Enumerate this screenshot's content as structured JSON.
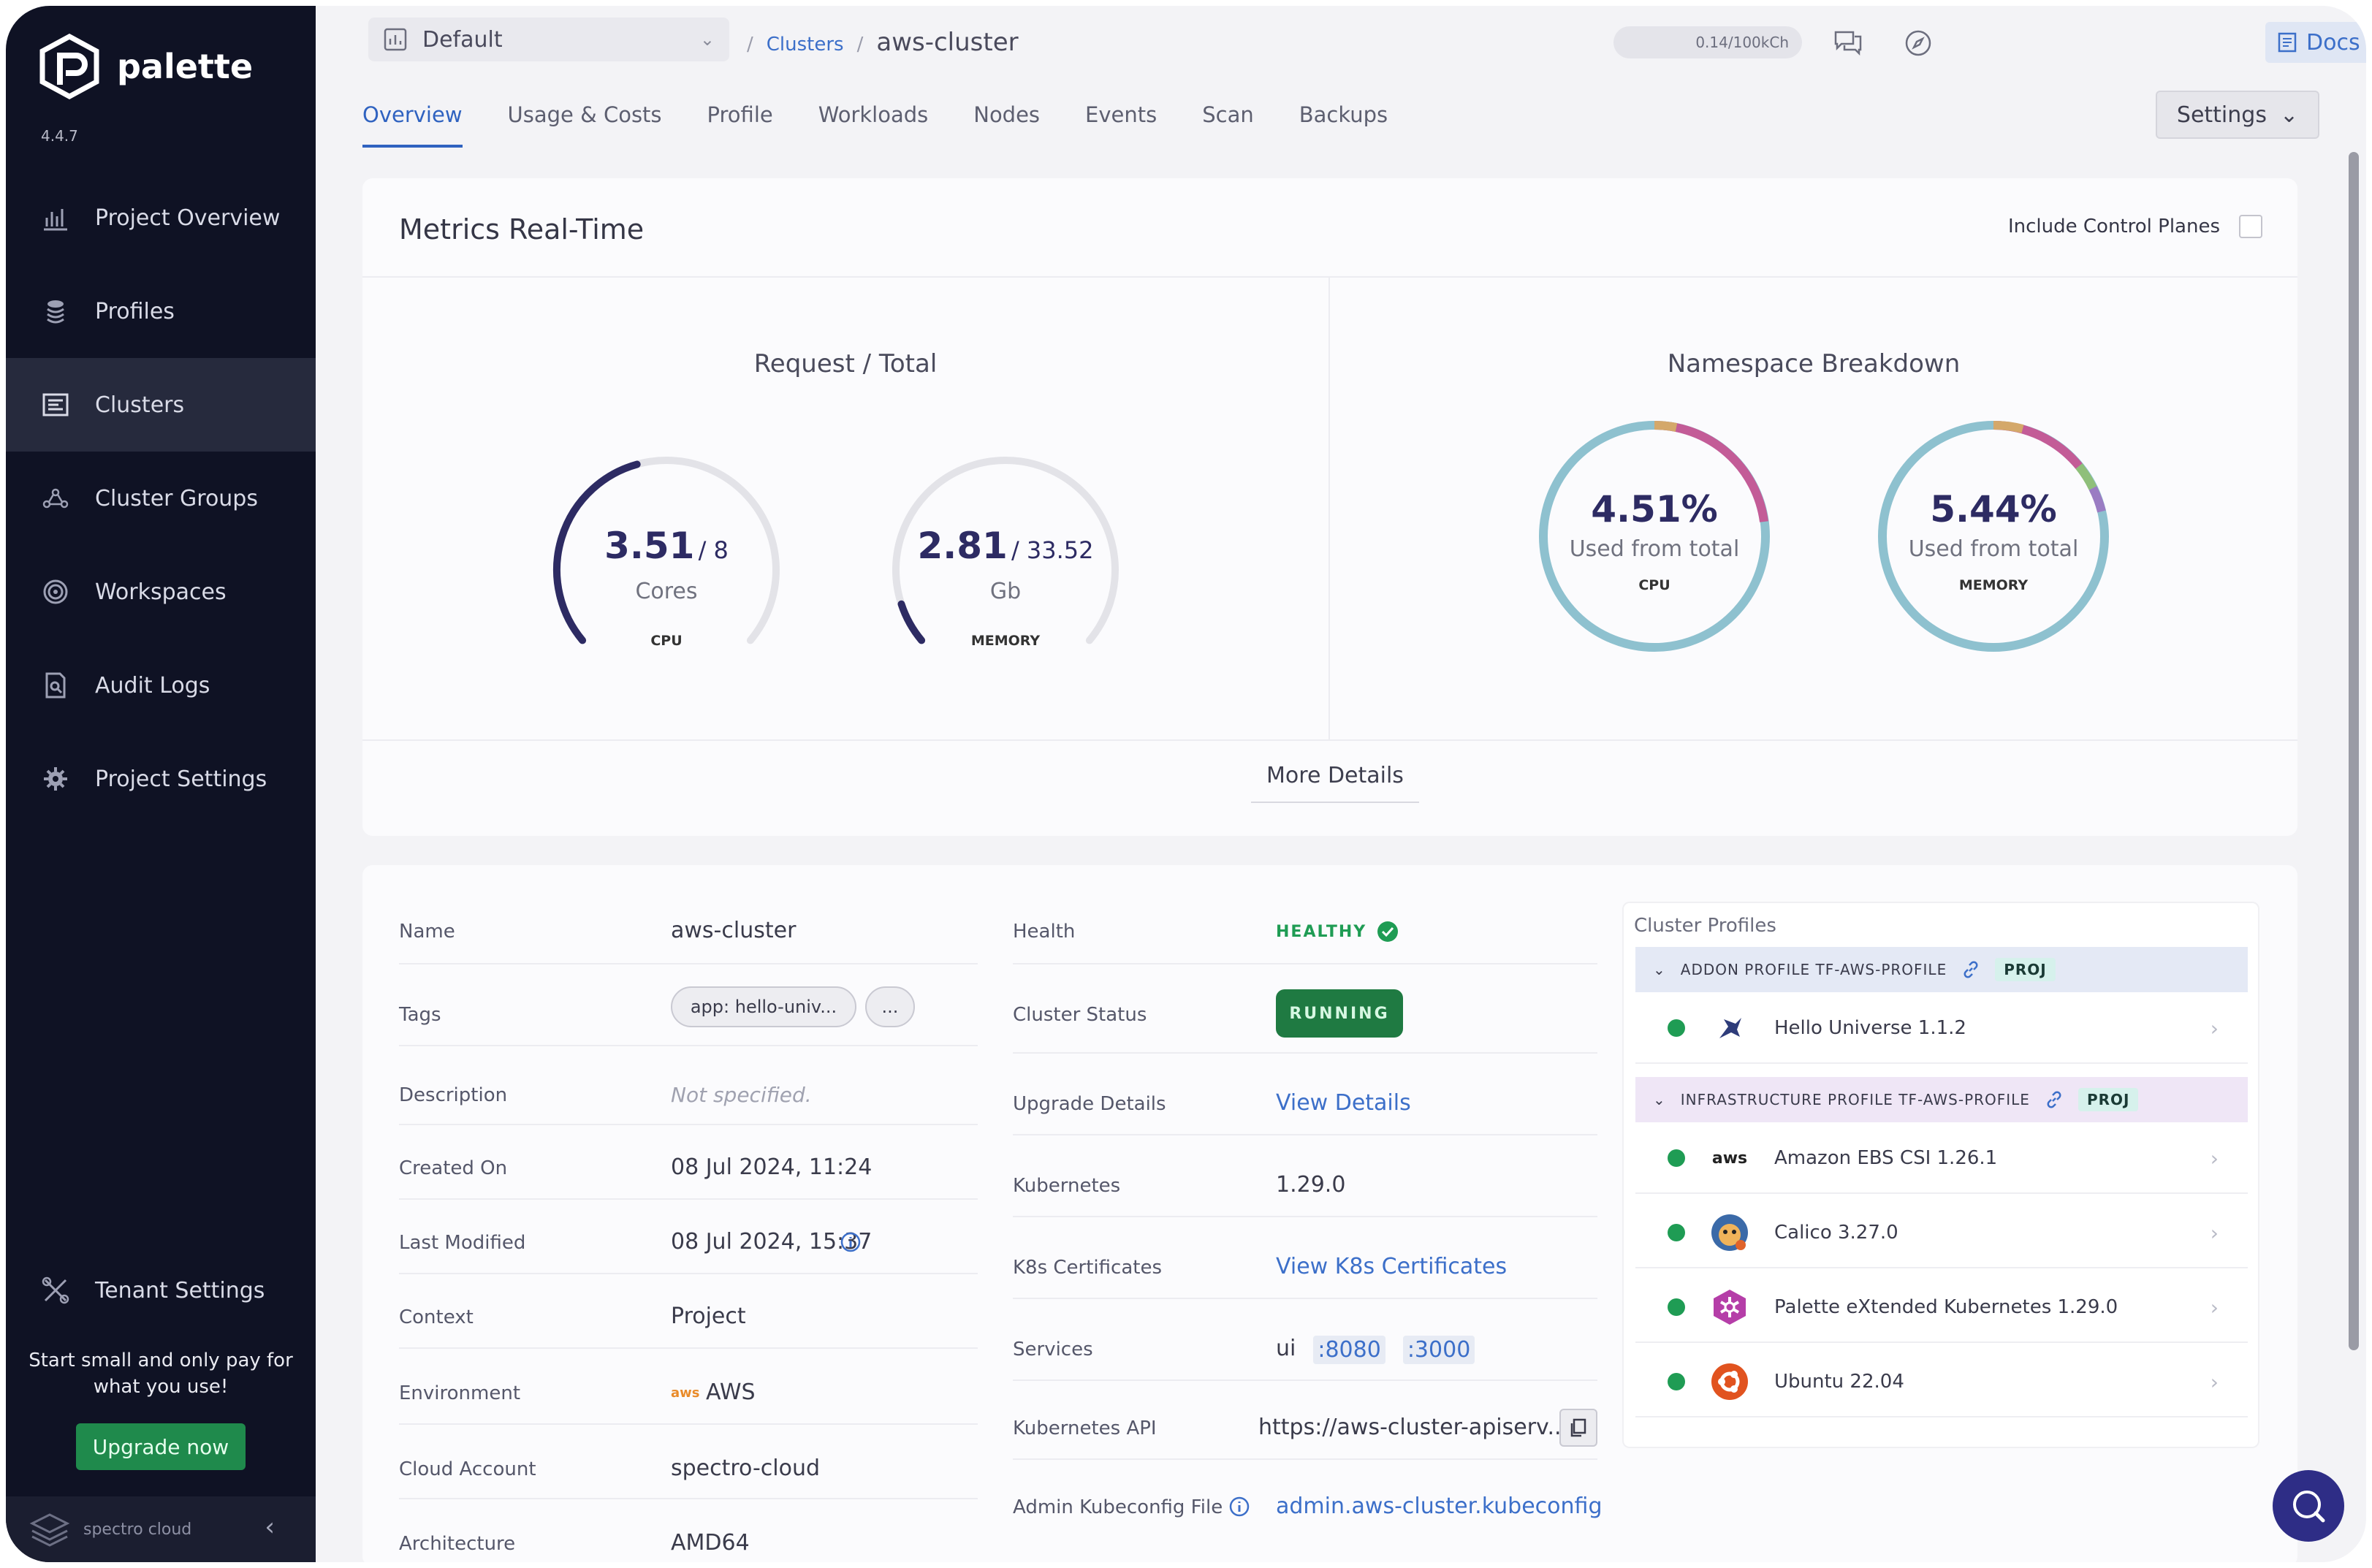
{
  "app": {
    "logo_text": "palette",
    "version": "4.4.7"
  },
  "sidebar": {
    "items": [
      {
        "label": "Project Overview",
        "icon": "chart-icon"
      },
      {
        "label": "Profiles",
        "icon": "stack-icon"
      },
      {
        "label": "Clusters",
        "icon": "clusters-icon"
      },
      {
        "label": "Cluster Groups",
        "icon": "network-icon"
      },
      {
        "label": "Workspaces",
        "icon": "target-icon"
      },
      {
        "label": "Audit Logs",
        "icon": "document-search-icon"
      },
      {
        "label": "Project Settings",
        "icon": "gear-icon"
      }
    ],
    "tenant_label": "Tenant Settings",
    "promo": "Start small and only pay for what you use!",
    "upgrade_label": "Upgrade now",
    "brand": "spectro cloud"
  },
  "topbar": {
    "project": "Default",
    "breadcrumb_link": "Clusters",
    "breadcrumb_sep": "/",
    "breadcrumb_current": "aws-cluster",
    "usage": "0.14/100kCh",
    "docs_label": "Docs"
  },
  "tabs": [
    "Overview",
    "Usage & Costs",
    "Profile",
    "Workloads",
    "Nodes",
    "Events",
    "Scan",
    "Backups"
  ],
  "active_tab": "Overview",
  "settings_label": "Settings",
  "metrics": {
    "title": "Metrics Real-Time",
    "control_planes_label": "Include Control Planes",
    "request_total_title": "Request / Total",
    "namespace_title": "Namespace Breakdown",
    "cpu_gauge": {
      "value": "3.51",
      "total": "/ 8",
      "unit": "Cores",
      "label": "CPU",
      "fraction": 0.44
    },
    "memory_gauge": {
      "value": "2.81",
      "total": "/ 33.52",
      "unit": "Gb",
      "label": "MEMORY",
      "fraction": 0.084
    },
    "cpu_donut": {
      "value": "4.51%",
      "sub": "Used from total",
      "label": "CPU"
    },
    "memory_donut": {
      "value": "5.44%",
      "sub": "Used from total",
      "label": "MEMORY"
    },
    "more_details": "More Details"
  },
  "details": {
    "left": [
      {
        "label": "Name",
        "value": "aws-cluster"
      },
      {
        "label": "Tags",
        "value": ""
      },
      {
        "label": "Description",
        "value": "Not specified."
      },
      {
        "label": "Created On",
        "value": "08 Jul 2024, 11:24"
      },
      {
        "label": "Last Modified",
        "value": "08 Jul 2024, 15:37"
      },
      {
        "label": "Context",
        "value": "Project"
      },
      {
        "label": "Environment",
        "value": "AWS"
      },
      {
        "label": "Cloud Account",
        "value": "spectro-cloud"
      },
      {
        "label": "Architecture",
        "value": "AMD64"
      }
    ],
    "tags": [
      "app: hello-univ...",
      "..."
    ],
    "middle": [
      {
        "label": "Health",
        "value": "HEALTHY"
      },
      {
        "label": "Cluster Status",
        "value": "RUNNING"
      },
      {
        "label": "Upgrade Details",
        "value": "View Details"
      },
      {
        "label": "Kubernetes",
        "value": "1.29.0"
      },
      {
        "label": "K8s Certificates",
        "value": "View K8s Certificates"
      },
      {
        "label": "Services",
        "value": "ui"
      },
      {
        "label": "Kubernetes API",
        "value": "https://aws-cluster-apiserv..."
      },
      {
        "label": "Admin Kubeconfig File",
        "value": "admin.aws-cluster.kubeconfig"
      }
    ],
    "ports": [
      ":8080",
      ":3000"
    ],
    "aws_logo_text": "aws"
  },
  "cluster_profiles": {
    "title": "Cluster Profiles",
    "addon_header": "ADDON PROFILE TF-AWS-PROFILE",
    "infra_header": "INFRASTRUCTURE PROFILE TF-AWS-PROFILE",
    "proj_badge": "PROJ",
    "addon_items": [
      "Hello Universe 1.1.2"
    ],
    "infra_items": [
      "Amazon EBS CSI 1.26.1",
      "Calico 3.27.0",
      "Palette eXtended Kubernetes 1.29.0",
      "Ubuntu 22.04"
    ]
  },
  "colors": {
    "accent": "#2f62c0",
    "sidebar": "#0f1224",
    "healthy": "#1f9c54",
    "gauge": "#2d2b63"
  }
}
